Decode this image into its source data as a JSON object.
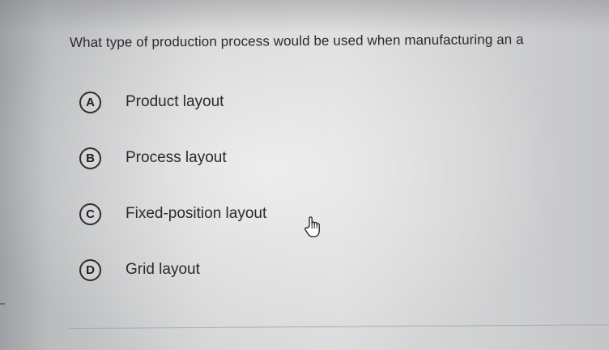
{
  "question": {
    "text": "What type of production process would be used when manufacturing an a"
  },
  "options": [
    {
      "letter": "A",
      "label": "Product layout"
    },
    {
      "letter": "B",
      "label": "Process layout"
    },
    {
      "letter": "C",
      "label": "Fixed-position layout"
    },
    {
      "letter": "D",
      "label": "Grid layout"
    }
  ],
  "cursor": {
    "icon": "hand-pointer-icon"
  }
}
